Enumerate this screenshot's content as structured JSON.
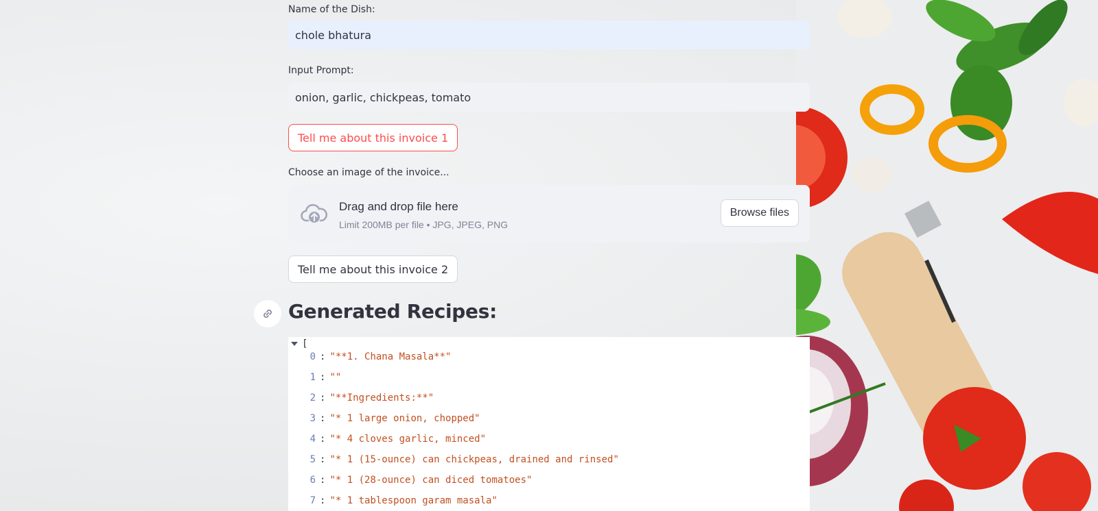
{
  "form": {
    "dish_label": "Name of the Dish:",
    "dish_value": "chole bhatura",
    "prompt_label": "Input Prompt:",
    "prompt_value": "onion, garlic, chickpeas, tomato",
    "button1_label": "Tell me about this invoice 1",
    "upload_label": "Choose an image of the invoice...",
    "upload_title": "Drag and drop file here",
    "upload_sub": "Limit 200MB per file • JPG, JPEG, PNG",
    "browse_label": "Browse files",
    "button2_label": "Tell me about this invoice 2"
  },
  "results": {
    "heading": "Generated Recipes:",
    "open_bracket": "[",
    "items": [
      {
        "index": "0",
        "value": "\"**1. Chana Masala**\""
      },
      {
        "index": "1",
        "value": "\"\""
      },
      {
        "index": "2",
        "value": "\"**Ingredients:**\""
      },
      {
        "index": "3",
        "value": "\"* 1 large onion, chopped\""
      },
      {
        "index": "4",
        "value": "\"* 4 cloves garlic, minced\""
      },
      {
        "index": "5",
        "value": "\"* 1 (15-ounce) can chickpeas, drained and rinsed\""
      },
      {
        "index": "6",
        "value": "\"* 1 (28-ounce) can diced tomatoes\""
      },
      {
        "index": "7",
        "value": "\"* 1 tablespoon garam masala\""
      }
    ]
  },
  "colors": {
    "primary": "#ff4b4b",
    "text": "#31333f",
    "json_string": "#c2501f",
    "json_index": "#6b7bb5"
  }
}
